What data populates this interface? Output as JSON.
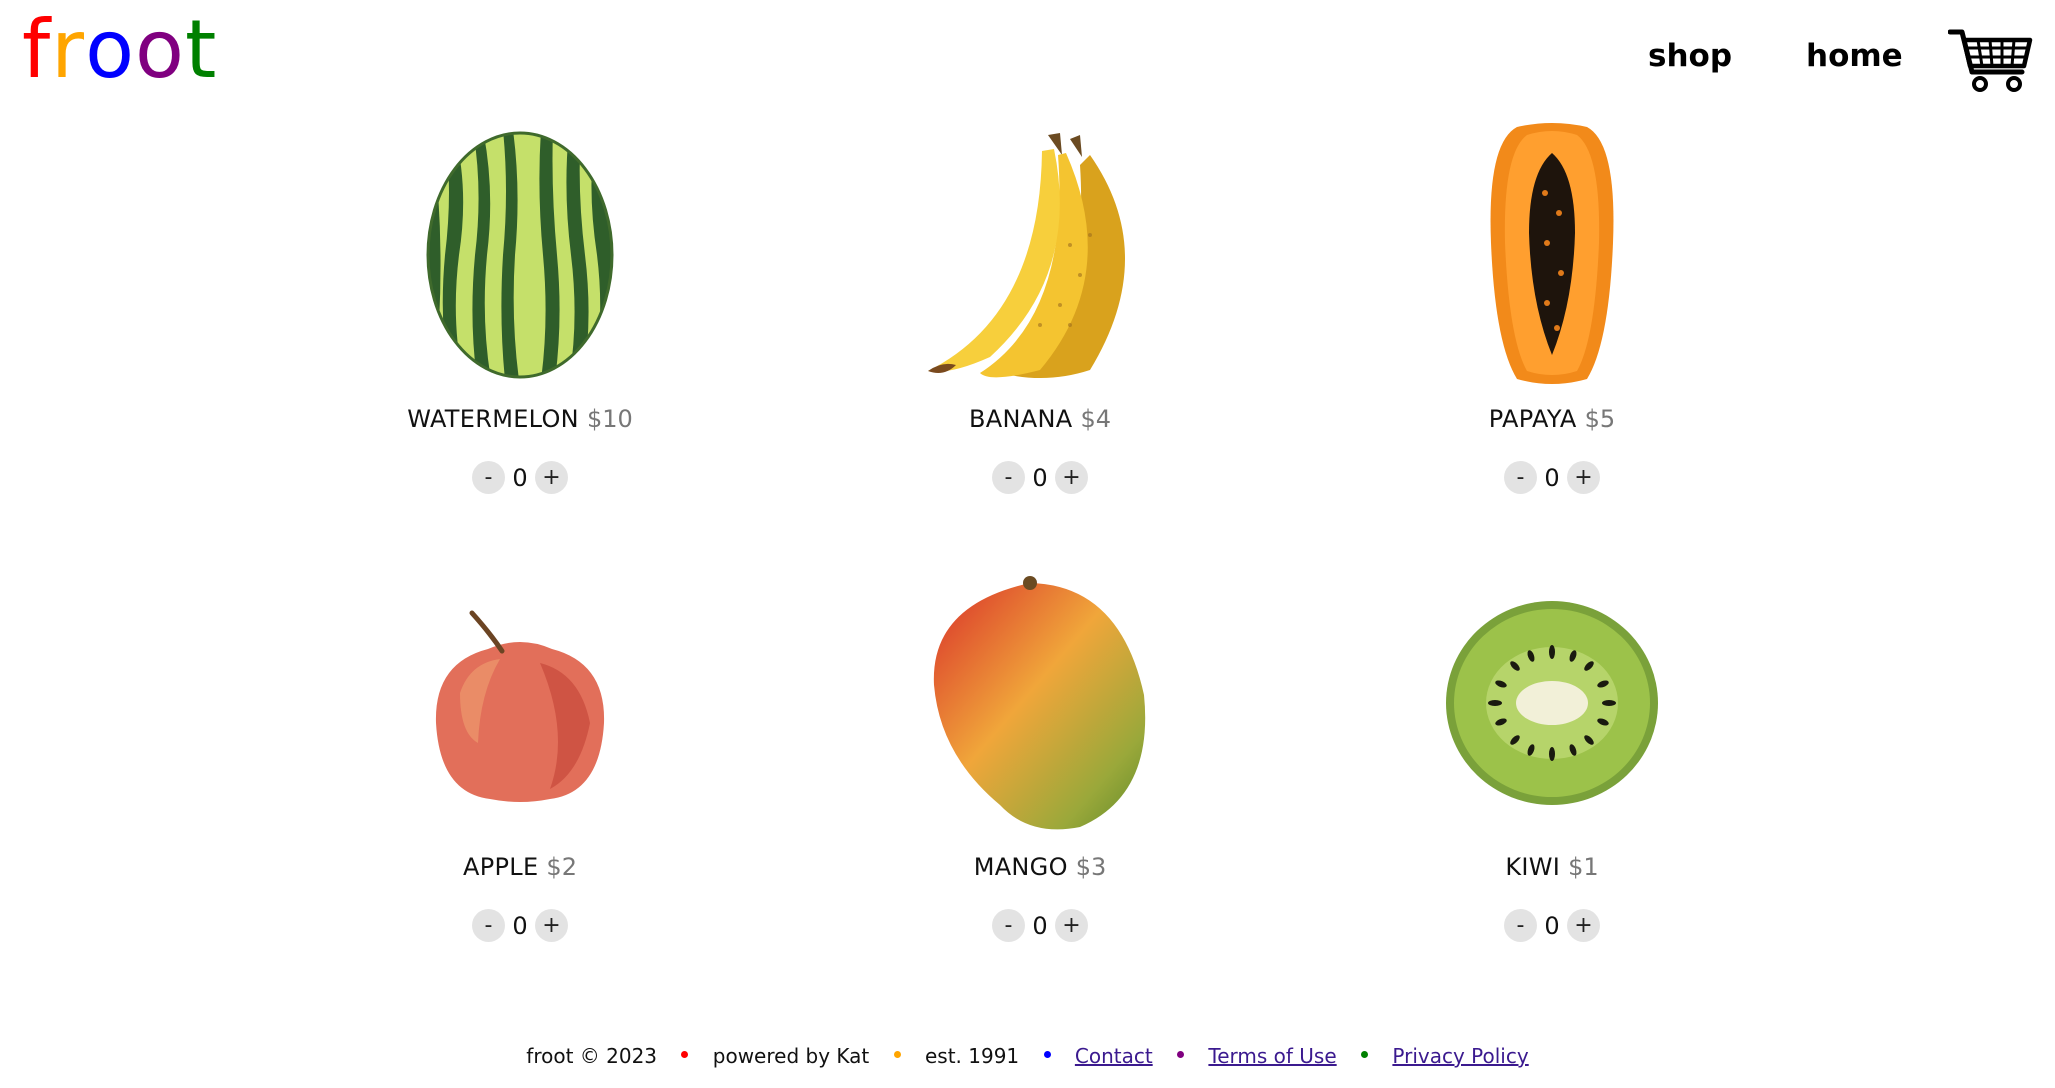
{
  "header": {
    "logo_letters": [
      {
        "char": "f",
        "color": "#ff0000"
      },
      {
        "char": "r",
        "color": "#ffa500"
      },
      {
        "char": "o",
        "color": "#0000ff"
      },
      {
        "char": "o",
        "color": "#800080"
      },
      {
        "char": "t",
        "color": "#008000"
      }
    ],
    "nav": {
      "shop_label": "shop",
      "home_label": "home"
    },
    "cart_icon": "shopping-cart-icon"
  },
  "products": [
    {
      "name": "WATERMELON",
      "price": "$10",
      "quantity": "0",
      "icon": "watermelon-image"
    },
    {
      "name": "BANANA",
      "price": "$4",
      "quantity": "0",
      "icon": "banana-image"
    },
    {
      "name": "PAPAYA",
      "price": "$5",
      "quantity": "0",
      "icon": "papaya-image"
    },
    {
      "name": "APPLE",
      "price": "$2",
      "quantity": "0",
      "icon": "apple-image"
    },
    {
      "name": "MANGO",
      "price": "$3",
      "quantity": "0",
      "icon": "mango-image"
    },
    {
      "name": "KIWI",
      "price": "$1",
      "quantity": "0",
      "icon": "kiwi-image"
    }
  ],
  "quantity_controls": {
    "decrement_label": "-",
    "increment_label": "+"
  },
  "footer": {
    "copyright": "froot © 2023",
    "powered_by": "powered by Kat",
    "established": "est. 1991",
    "links": {
      "contact": "Contact",
      "terms": "Terms of Use",
      "privacy": "Privacy Policy"
    },
    "dot_colors": [
      "#ff0000",
      "#ffa500",
      "#0000ff",
      "#800080",
      "#008000"
    ]
  },
  "colors": {
    "price_text": "#777777",
    "qty_button_bg": "#e3e3e3",
    "link": "#3b1a8f"
  }
}
